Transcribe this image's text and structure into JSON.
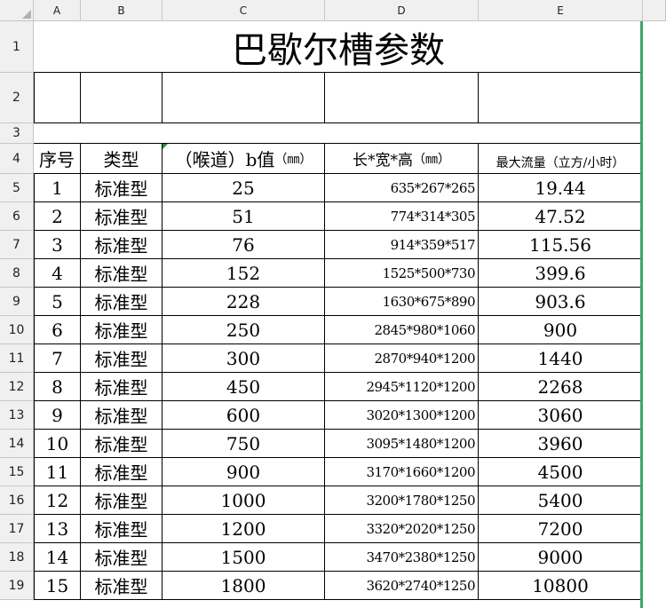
{
  "columns": [
    "A",
    "B",
    "C",
    "D",
    "E"
  ],
  "rows": [
    "1",
    "2",
    "3",
    "4",
    "5",
    "6",
    "7",
    "8",
    "9",
    "10",
    "11",
    "12",
    "13",
    "14",
    "15",
    "16",
    "17",
    "18",
    "19"
  ],
  "title": "巴歇尔槽参数",
  "headers": {
    "seq": "序号",
    "type": "类型",
    "throat_main": "（喉道）b值",
    "throat_unit": "（㎜）",
    "dims_main": "长*宽*高",
    "dims_unit": "（㎜）",
    "flow": "最大流量（立方/小时）"
  },
  "table": [
    {
      "seq": "1",
      "type": "标准型",
      "b": "25",
      "dims": "635*267*265",
      "flow": "19.44"
    },
    {
      "seq": "2",
      "type": "标准型",
      "b": "51",
      "dims": "774*314*305",
      "flow": "47.52"
    },
    {
      "seq": "3",
      "type": "标准型",
      "b": "76",
      "dims": "914*359*517",
      "flow": "115.56"
    },
    {
      "seq": "4",
      "type": "标准型",
      "b": "152",
      "dims": "1525*500*730",
      "flow": "399.6"
    },
    {
      "seq": "5",
      "type": "标准型",
      "b": "228",
      "dims": "1630*675*890",
      "flow": "903.6"
    },
    {
      "seq": "6",
      "type": "标准型",
      "b": "250",
      "dims": "2845*980*1060",
      "flow": "900"
    },
    {
      "seq": "7",
      "type": "标准型",
      "b": "300",
      "dims": "2870*940*1200",
      "flow": "1440"
    },
    {
      "seq": "8",
      "type": "标准型",
      "b": "450",
      "dims": "2945*1120*1200",
      "flow": "2268"
    },
    {
      "seq": "9",
      "type": "标准型",
      "b": "600",
      "dims": "3020*1300*1200",
      "flow": "3060"
    },
    {
      "seq": "10",
      "type": "标准型",
      "b": "750",
      "dims": "3095*1480*1200",
      "flow": "3960"
    },
    {
      "seq": "11",
      "type": "标准型",
      "b": "900",
      "dims": "3170*1660*1200",
      "flow": "4500"
    },
    {
      "seq": "12",
      "type": "标准型",
      "b": "1000",
      "dims": "3200*1780*1250",
      "flow": "5400"
    },
    {
      "seq": "13",
      "type": "标准型",
      "b": "1200",
      "dims": "3320*2020*1250",
      "flow": "7200"
    },
    {
      "seq": "14",
      "type": "标准型",
      "b": "1500",
      "dims": "3470*2380*1250",
      "flow": "9000"
    },
    {
      "seq": "15",
      "type": "标准型",
      "b": "1800",
      "dims": "3620*2740*1250",
      "flow": "10800"
    }
  ],
  "colors": {
    "selection_border": "#3aa66a",
    "header_bg": "#f0f0f0",
    "gridline": "#d9d9d9"
  }
}
